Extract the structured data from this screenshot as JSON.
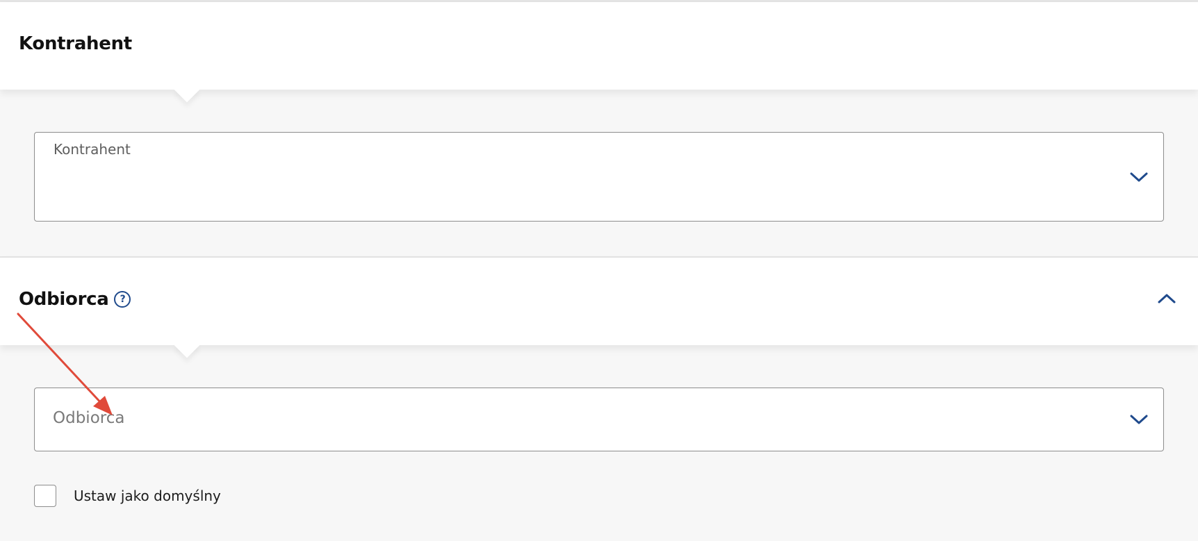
{
  "sections": [
    {
      "title": "Kontrahent",
      "field": {
        "label": "Kontrahent",
        "value": ""
      }
    },
    {
      "title": "Odbiorca",
      "help_icon": "help-circle-icon",
      "collapse_icon": "chevron-up-icon",
      "field": {
        "placeholder": "Odbiorca"
      },
      "checkbox": {
        "label": "Ustaw jako domyślny",
        "checked": false
      }
    }
  ],
  "icons": {
    "help": "?",
    "dropdown": "chevron-down-icon"
  },
  "colors": {
    "accent": "#1f4a8c",
    "annotation": "#e04a3a",
    "background": "#f7f7f7"
  }
}
